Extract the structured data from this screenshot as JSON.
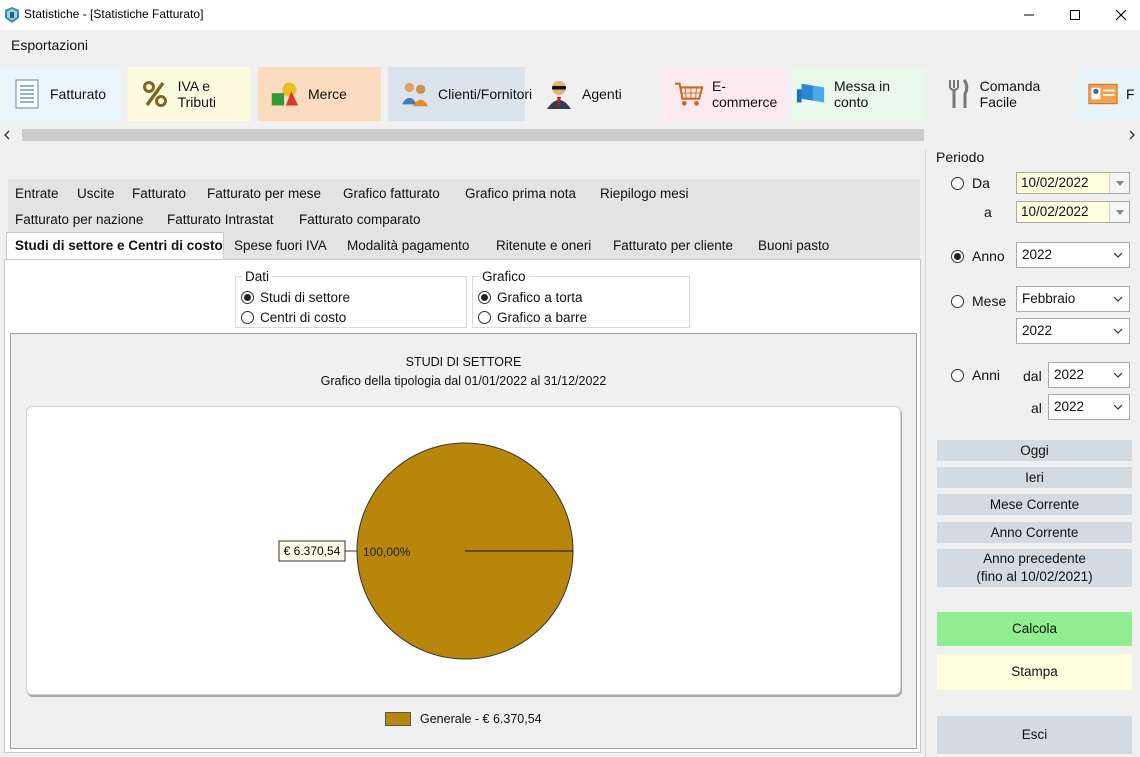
{
  "window": {
    "title": "Statistiche - [Statistiche Fatturato]"
  },
  "menu": {
    "export": "Esportazioni"
  },
  "toolbar": [
    {
      "label": "Fatturato",
      "icon": "document-lines-icon",
      "bg": "#eaf6f9"
    },
    {
      "label": "IVA e Tributi",
      "icon": "percent-icon",
      "bg": "#fdfbe0"
    },
    {
      "label": "Merce",
      "icon": "shapes-icon",
      "bg": "#fbdcc0"
    },
    {
      "label": "Clienti/Fornitori",
      "icon": "people-icon",
      "bg": "#dbe3ec"
    },
    {
      "label": "Agenti",
      "icon": "agent-icon",
      "bg": "#f0f0f0"
    },
    {
      "label": "E-commerce",
      "icon": "cart-icon",
      "bg": "#fdeaf0"
    },
    {
      "label": "Messa in conto",
      "icon": "flag-icon",
      "bg": "#e8f8ea"
    },
    {
      "label": "Comanda Facile",
      "icon": "cutlery-icon",
      "bg": "#f0f0f0"
    },
    {
      "label": "F",
      "icon": "id-card-icon",
      "bg": "#e6f4f8"
    }
  ],
  "tabs": {
    "row1": [
      "Entrate",
      "Uscite",
      "Fatturato",
      "Fatturato per mese",
      "Grafico fatturato",
      "Grafico prima nota",
      "Riepilogo mesi"
    ],
    "row2": [
      "Fatturato per nazione",
      "Fatturato Intrastat",
      "Fatturato comparato"
    ],
    "row3": [
      "Studi di settore e Centri di costo",
      "Spese fuori IVA",
      "Modalità pagamento",
      "Ritenute e oneri",
      "Fatturato per cliente",
      "Buoni pasto"
    ],
    "active": "Studi di settore e Centri di costo"
  },
  "dati": {
    "legend": "Dati",
    "opt1": "Studi di settore",
    "opt2": "Centri di costo",
    "selected": 1
  },
  "grafico": {
    "legend": "Grafico",
    "opt1": "Grafico a torta",
    "opt2": "Grafico a barre",
    "selected": 1
  },
  "chart_data": {
    "type": "pie",
    "title": "STUDI DI SETTORE",
    "subtitle": "Grafico della tipologia dal 01/01/2022 al 31/12/2022",
    "slices": [
      {
        "label": "Generale",
        "value": 6370.54,
        "value_label": "€ 6.370,54",
        "percent_label": "100,00%",
        "color": "#b8860b"
      }
    ],
    "legend": [
      "Generale - € 6.370,54"
    ],
    "legend_placement": "bottom"
  },
  "periodo": {
    "title": "Periodo",
    "da_label": "Da",
    "a_label": "a",
    "da_value": "10/02/2022",
    "a_value": "10/02/2022",
    "anno_label": "Anno",
    "anno_value": "2022",
    "mese_label": "Mese",
    "mese_value": "Febbraio",
    "mese_anno_value": "2022",
    "anni_label": "Anni",
    "dal_label": "dal",
    "al_label": "al",
    "dal_value": "2022",
    "al_value": "2022",
    "selected": "Anno"
  },
  "buttons": {
    "oggi": "Oggi",
    "ieri": "Ieri",
    "mese_corrente": "Mese Corrente",
    "anno_corrente": "Anno Corrente",
    "anno_precedente_1": "Anno precedente",
    "anno_precedente_2": "(fino al 10/02/2021)",
    "calcola": "Calcola",
    "stampa": "Stampa",
    "esci": "Esci"
  },
  "colors": {
    "calcola": "#90ee90",
    "stampa": "#ffffe0",
    "button": "#d3dae0",
    "pie": "#b8860b",
    "input_highlight": "#ffffe0"
  }
}
